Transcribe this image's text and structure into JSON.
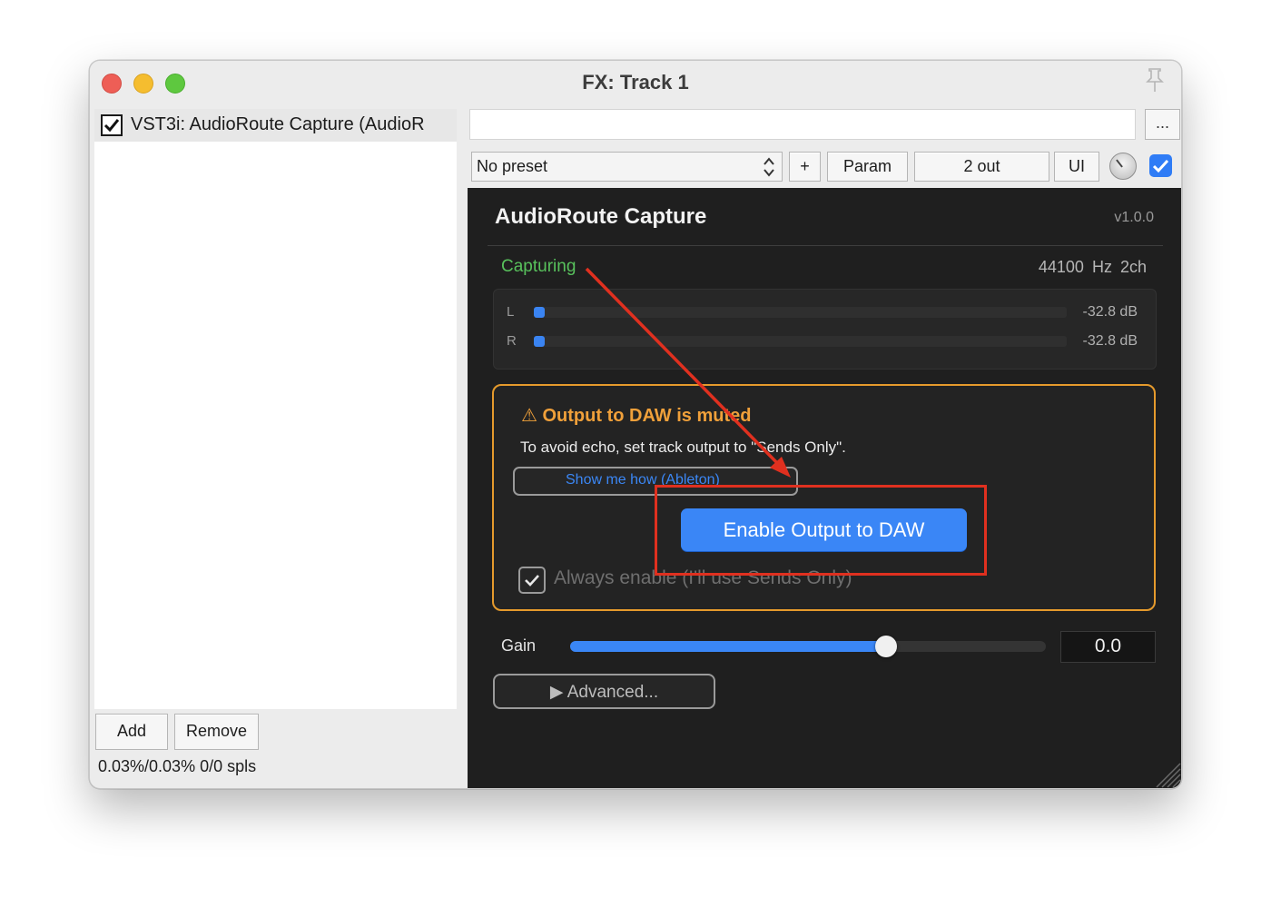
{
  "window": {
    "title": "FX: Track 1"
  },
  "fx_list": {
    "items": [
      {
        "label": "VST3i: AudioRoute Capture (AudioR",
        "enabled": true
      }
    ],
    "add_label": "Add",
    "remove_label": "Remove",
    "status": "0.03%/0.03% 0/0 spls"
  },
  "toolbar": {
    "name_value": "",
    "more_label": "...",
    "preset_value": "No preset",
    "add_preset_label": "+",
    "param_label": "Param",
    "out_label": "2 out",
    "ui_label": "UI",
    "bypass_checked": true
  },
  "plugin": {
    "title": "AudioRoute Capture",
    "version": "v1.0.0",
    "status": "Capturing",
    "sample_rate": "44100 Hz",
    "channels": "2ch",
    "meters": [
      {
        "label": "L",
        "value": "-32.8 dB",
        "level": 0.02
      },
      {
        "label": "R",
        "value": "-32.8 dB",
        "level": 0.02
      }
    ],
    "warning": {
      "title": "⚠ Output to DAW is muted",
      "text": "To avoid echo, set track output to \"Sends Only\".",
      "howto_label": "Show me how (Ableton)",
      "enable_label": "Enable Output to DAW",
      "always_label": "Always enable (I'll use Sends Only)",
      "always_checked": true
    },
    "gain": {
      "label": "Gain",
      "value": "0.0",
      "fraction": 0.665
    },
    "advanced_label": "▶ Advanced..."
  },
  "colors": {
    "accent_blue": "#3a86f6",
    "capturing_green": "#58c15c",
    "warning_orange": "#e59a2c",
    "annotation_red": "#e0301f"
  }
}
